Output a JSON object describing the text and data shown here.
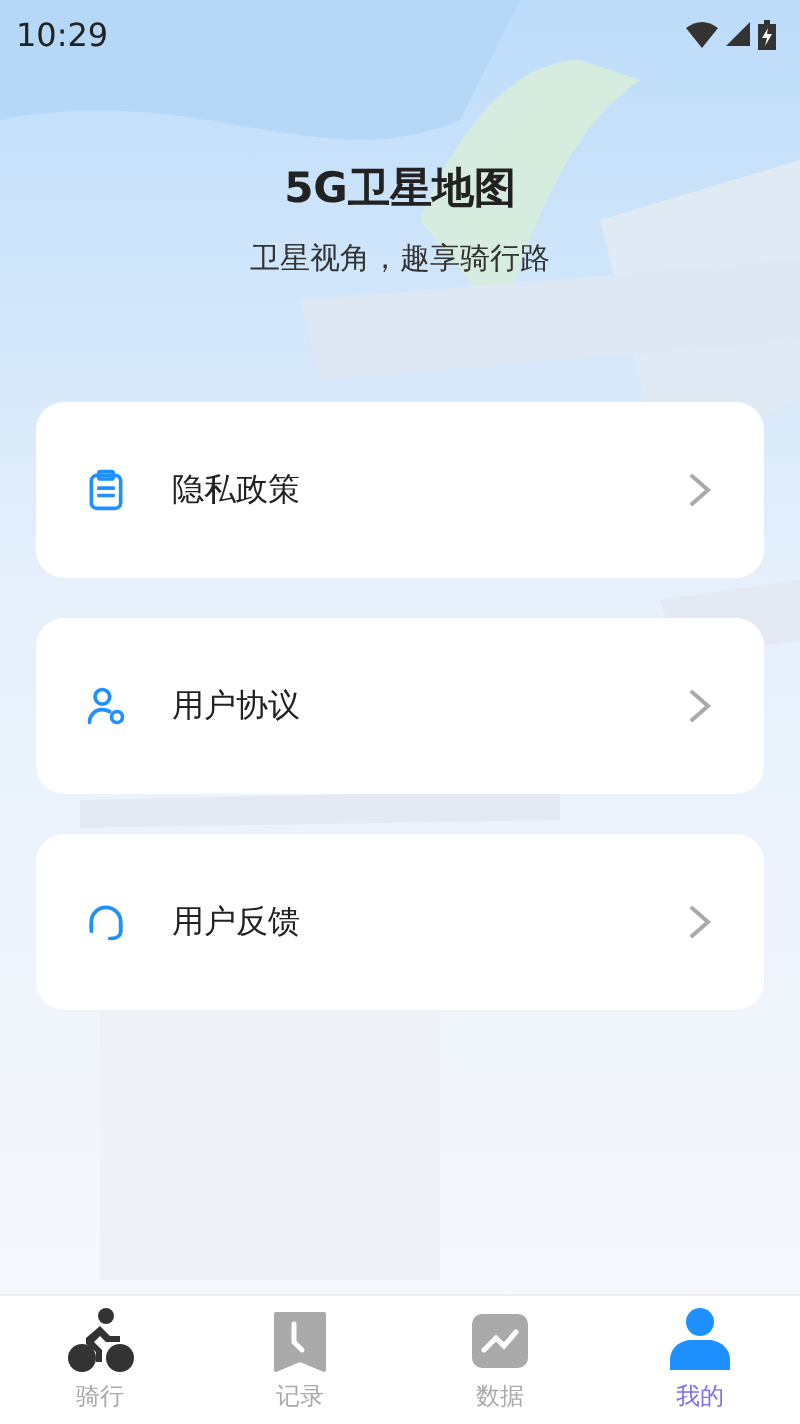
{
  "status_bar": {
    "time": "10:29"
  },
  "header": {
    "title": "5G卫星地图",
    "subtitle": "卫星视角，趣享骑行路"
  },
  "menu": [
    {
      "kind": "policy",
      "label": "隐私政策"
    },
    {
      "kind": "agreement",
      "label": "用户协议"
    },
    {
      "kind": "feedback",
      "label": "用户反馈"
    }
  ],
  "tabs": [
    {
      "kind": "ride",
      "label": "骑行",
      "selected": false
    },
    {
      "kind": "record",
      "label": "记录",
      "selected": false
    },
    {
      "kind": "data",
      "label": "数据",
      "selected": false
    },
    {
      "kind": "mine",
      "label": "我的",
      "selected": true
    }
  ]
}
